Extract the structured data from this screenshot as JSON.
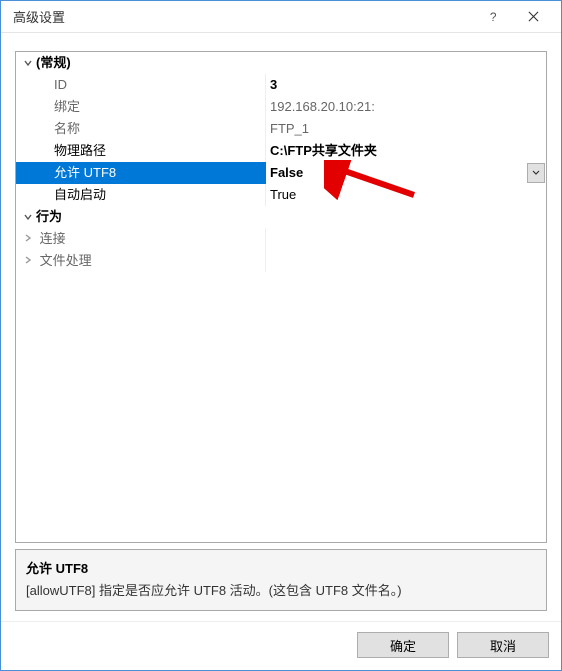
{
  "window": {
    "title": "高级设置"
  },
  "grid": {
    "cat_general": "(常规)",
    "cat_behavior": "行为",
    "sub_connection": "连接",
    "sub_filehandling": "文件处理",
    "props": {
      "id_label": "ID",
      "id_value": "3",
      "binding_label": "绑定",
      "binding_value": "192.168.20.10:21:",
      "name_label": "名称",
      "name_value": "FTP_1",
      "path_label": "物理路径",
      "path_value": "C:\\FTP共享文件夹",
      "utf8_label": "允许 UTF8",
      "utf8_value": "False",
      "autostart_label": "自动启动",
      "autostart_value": "True"
    }
  },
  "desc": {
    "title": "允许 UTF8",
    "body": "[allowUTF8] 指定是否应允许 UTF8 活动。(这包含 UTF8 文件名。)"
  },
  "buttons": {
    "ok": "确定",
    "cancel": "取消"
  }
}
